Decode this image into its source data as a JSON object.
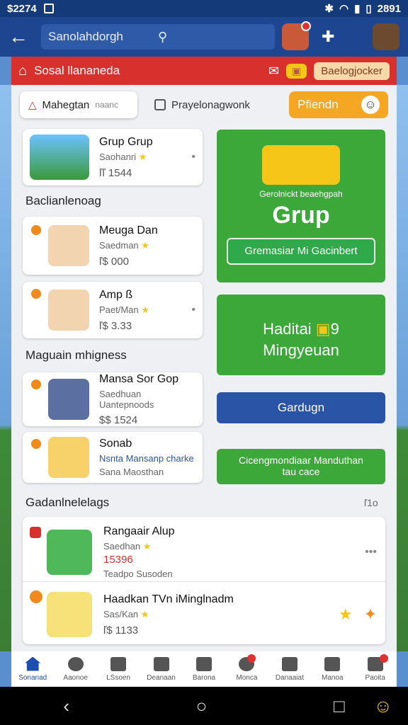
{
  "status": {
    "time": "$2274",
    "clock": "2891"
  },
  "header": {
    "search_text": "Sanolahdorgh"
  },
  "redbar": {
    "title": "Sosal llananeda",
    "pill": "Baelogjocker"
  },
  "tabs": [
    {
      "label": "Mahegtan",
      "suffix": "naanc"
    },
    {
      "label": "Prayelonagwonk"
    },
    {
      "label": "Pfiendn"
    }
  ],
  "left": {
    "group_card": {
      "title": "Grup Grup",
      "sub": "Saohanri",
      "price": "ľľ 1544"
    },
    "section1": "Baclianlenoag",
    "people": [
      {
        "name": "Meuga Dan",
        "sub": "Saedman",
        "value": "ľ$ 000"
      },
      {
        "name": "Amp ß",
        "sub": "Paet/Man",
        "value": "ľ$ 3.33"
      }
    ],
    "section2": "Maguain mhigness",
    "people2": [
      {
        "name": "Mansa Sor Gop",
        "sub": "Saedhuan Uantepnoods",
        "value": "$$ 1524"
      },
      {
        "name": "Sonab",
        "sub": "Nsnta Mansanp charke",
        "value": "Sana Maosthan"
      }
    ]
  },
  "right": {
    "promo": {
      "kicker": "Gerolnickt beaehgpah",
      "title": "Grup",
      "button": "Gremasiar Mi Gacinbert"
    },
    "weekly": {
      "title1": "Haditai",
      "title2": "Mingyeuan",
      "num": "9"
    },
    "blue_button": "Gardugn",
    "green_button": "Cicengmondiaar Manduthan",
    "green_button_sub": "tau cace"
  },
  "section3": {
    "label": "Gadanlnelelags",
    "count": "ľ1o"
  },
  "feed": [
    {
      "title": "Rangaair Alup",
      "sub": "Saedhan",
      "value": "15396",
      "extra": "Teadpo Susoden"
    },
    {
      "title": "Haadkan TVn iMinglnadm",
      "sub": "Sas/Kan",
      "value": "ľ$ 1133"
    }
  ],
  "nav": [
    "Sonanad",
    "Aaonoe",
    "LSsoen",
    "Deanaan",
    "Barona",
    "Monca",
    "Danaaiat",
    "Manoa",
    "Paoita"
  ],
  "colors": {
    "topbar": "#1d4590",
    "red": "#d8302c",
    "green": "#3ca83a",
    "orange": "#f5a623",
    "blue": "#2a55a6"
  }
}
